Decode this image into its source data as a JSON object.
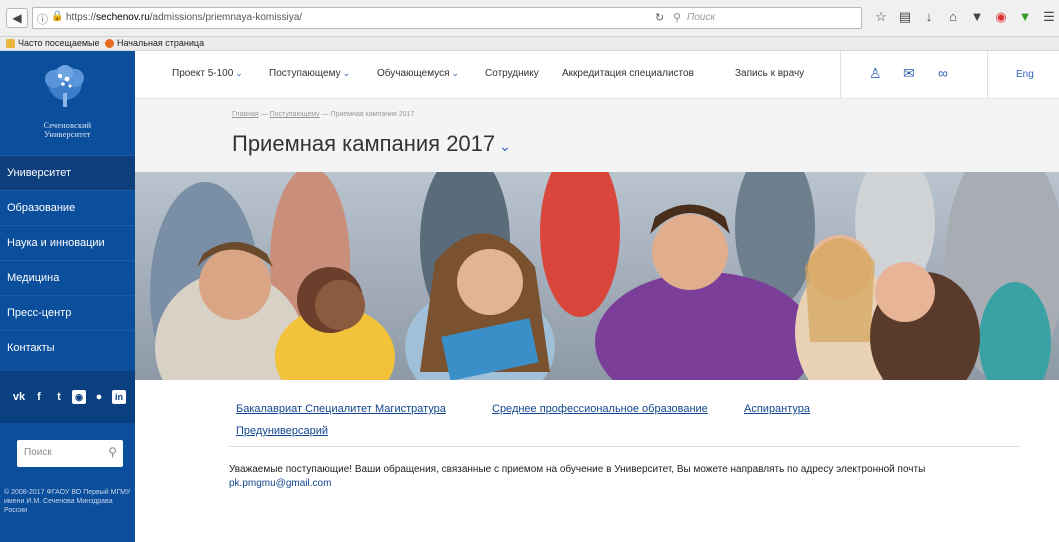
{
  "browser": {
    "url_prefix": "https://",
    "url_domain": "sechenov.ru",
    "url_path": "/admissions/priemnaya-komissiya/",
    "search_placeholder": "Поиск",
    "bookmarks": [
      "Часто посещаемые",
      "Начальная страница"
    ]
  },
  "sidebar": {
    "logo_line1": "Сеченовский",
    "logo_line2": "Университет",
    "items": [
      "Университет",
      "Образование",
      "Наука и инновации",
      "Медицина",
      "Пресс-центр",
      "Контакты"
    ],
    "social": [
      "vk-icon",
      "facebook-icon",
      "twitter-icon",
      "instagram-icon",
      "flickr-icon",
      "linkedin-icon"
    ],
    "search_placeholder": "Поиск",
    "copyright": "© 2008-2017 ФГАОУ ВО Первый МГМУ имени И.М. Сеченова Минздрава России"
  },
  "topnav": {
    "items": [
      "Проект 5-100",
      "Поступающему",
      "Обучающемуся",
      "Сотруднику",
      "Аккредитация специалистов",
      "Запись к врачу"
    ],
    "lang": "Eng"
  },
  "header": {
    "breadcrumb": [
      "Главная",
      "Поступающему",
      "Приемная кампания 2017"
    ],
    "breadcrumb_sep": "—",
    "title": "Приемная кампания 2017"
  },
  "links": {
    "bachelor": "Бакалавриат Специалитет Магистратура",
    "spo": "Среднее профессиональное образование",
    "phd": "Аспирантура",
    "pre": "Предуниверсарий"
  },
  "notice": {
    "text": "Уважаемые поступающие! Ваши обращения, связанные с приемом на обучение в Университет, Вы можете направлять по адресу электронной почты",
    "email": "pk.pmgmu@gmail.com"
  },
  "colors": {
    "brand": "#0b4e9b",
    "accent": "#2f64b8",
    "link": "#12468f"
  }
}
